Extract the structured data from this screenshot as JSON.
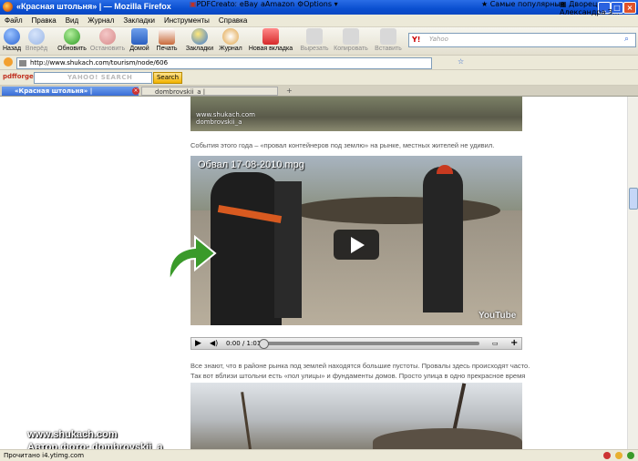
{
  "window": {
    "title": "«Красная штольня» | — Mozilla Firefox"
  },
  "menu": [
    "Файл",
    "Правка",
    "Вид",
    "Журнал",
    "Закладки",
    "Инструменты",
    "Справка"
  ],
  "toolbar": {
    "back": "Назад",
    "forward": "Вперёд",
    "reload": "Обновить",
    "stop": "Остановить",
    "home": "Домой",
    "print": "Печать",
    "bookmarks": "Закладки",
    "history": "Журнал",
    "newtab": "Новая вкладка",
    "cut": "Вырезать",
    "copy": "Копировать",
    "paste": "Вставить"
  },
  "search": {
    "brand": "Y!",
    "placeholder": "Yahoo"
  },
  "urlbar": {
    "url": "http://www.shukach.com/tourism/node/606",
    "bm_popular": "Самые популярные",
    "bm_palace": "Дворец Александра З..."
  },
  "pdfforge": {
    "logo": "pdfforge",
    "brand": "YAHOO! SEARCH",
    "search_btn": "Search",
    "pdfcreator": "PDFCreator",
    "ebay": "eBay",
    "amazon": "Amazon",
    "options": "Options"
  },
  "tabs": [
    {
      "label": "«Красная штольня» |"
    },
    {
      "label": "dombrovskii_a |"
    }
  ],
  "content": {
    "photo_credit_1": "www.shukach.com",
    "photo_credit_2": "dombrovskii_a",
    "para1": "События этого года – «провал контейнеров под землю» на рынке, местных жителей не удивил.",
    "video_title": "Обвал 17-08-2010.mpg",
    "video_time": "0:00 / 1:01",
    "video_brand": "YouTube",
    "video_progress": 0,
    "para2": "Все знают, что в районе рынка под землей находятся большие пустоты. Провалы здесь происходят часто. Так вот вблизи штольни есть «пол улицы» и фундаменты домов. Просто улица в одно прекрасное время взяла и провалилась."
  },
  "watermark": {
    "line1": "www.shukach.com",
    "line2": "Автор фото: dombrovskii_a"
  },
  "status": {
    "text": "Прочитано i4.ytimg.com"
  },
  "colors": {
    "titlebar": "#0a4fd0",
    "accent": "#3a6ed6",
    "arrow": "#3a9a2a"
  }
}
